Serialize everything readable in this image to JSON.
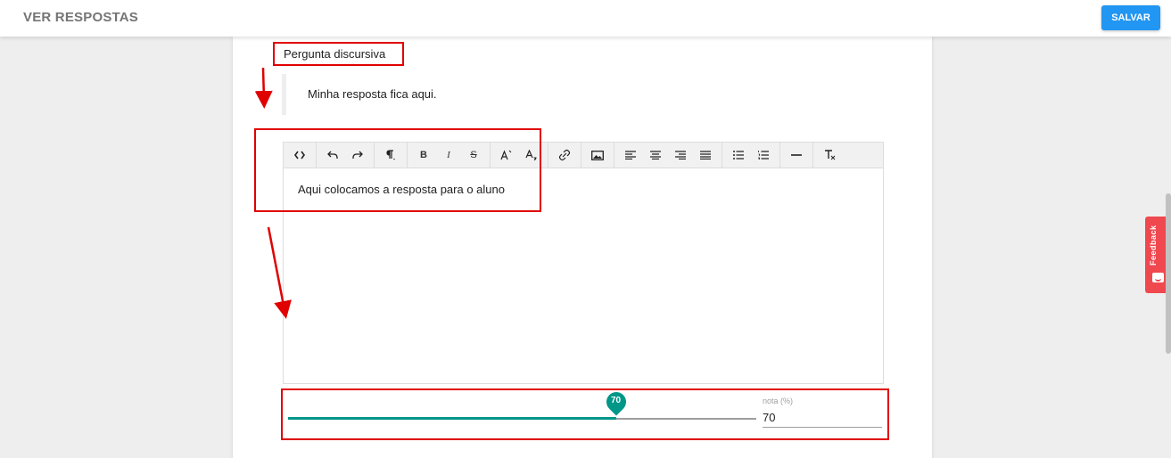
{
  "topbar": {
    "title": "VER RESPOSTAS",
    "save_label": "SALVAR"
  },
  "question": {
    "label": "Pergunta discursiva",
    "student_answer": "Minha resposta fica aqui."
  },
  "editor": {
    "content": "Aqui colocamos a resposta para o aluno",
    "toolbar": [
      [
        "code-view-icon"
      ],
      [
        "undo-icon",
        "redo-icon"
      ],
      [
        "paragraph-icon"
      ],
      [
        "bold-icon",
        "italic-icon",
        "strikethrough-icon"
      ],
      [
        "superscript-icon",
        "subscript-icon"
      ],
      [
        "link-icon"
      ],
      [
        "image-icon"
      ],
      [
        "align-left-icon",
        "align-center-icon",
        "align-right-icon",
        "align-justify-icon"
      ],
      [
        "bullet-list-icon",
        "numbered-list-icon"
      ],
      [
        "horizontal-rule-icon"
      ],
      [
        "clear-format-icon"
      ]
    ]
  },
  "grade": {
    "label": "nota (%)",
    "value": "70",
    "slider_value": 70,
    "slider_min": 0,
    "slider_max": 100
  },
  "feedback": {
    "label": "Feedback"
  },
  "colors": {
    "accent": "#2196f3",
    "slider": "#009688",
    "annotation": "#e00000",
    "feedback": "#f0484f"
  }
}
